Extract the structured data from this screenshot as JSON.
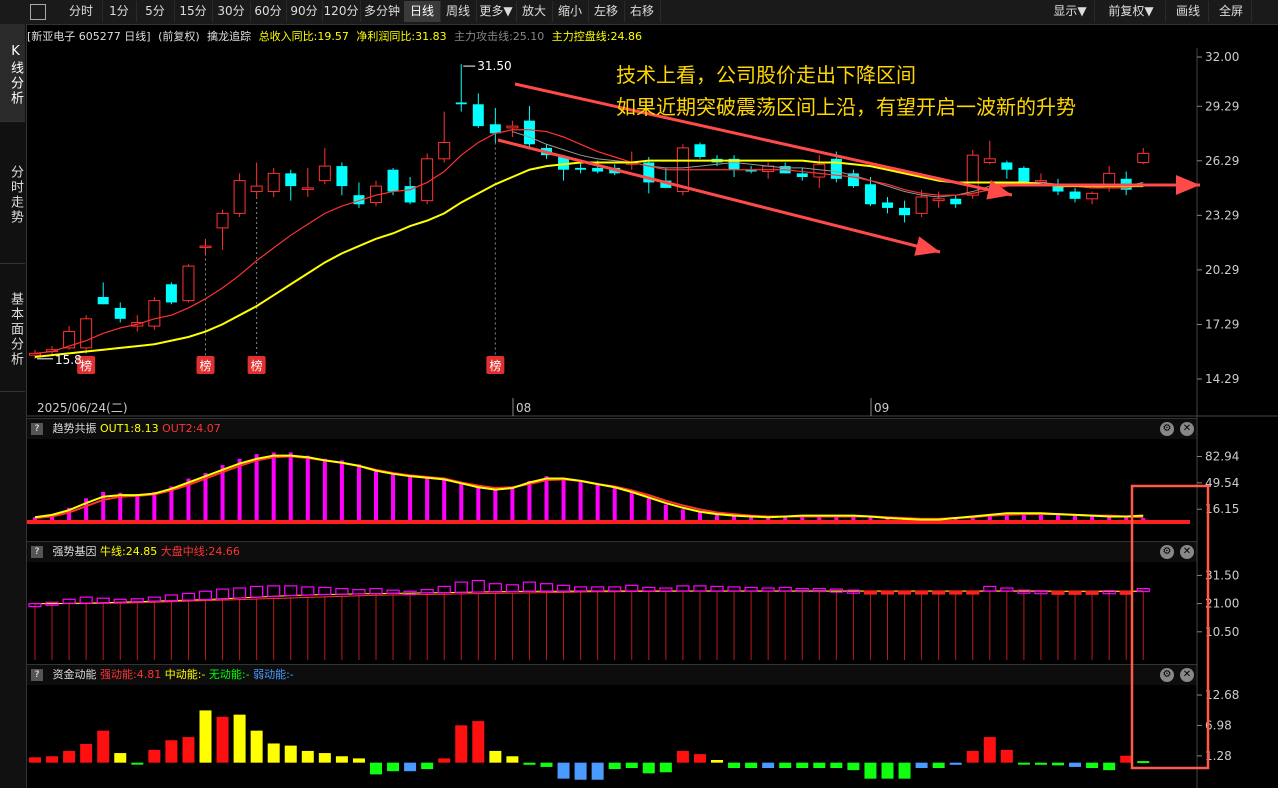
{
  "toolbar": {
    "items": [
      "分时",
      "1分",
      "5分",
      "15分",
      "30分",
      "60分",
      "90分",
      "120分",
      "多分钟",
      "日线",
      "周线",
      "更多▼",
      "放大",
      "缩小",
      "左移",
      "右移"
    ],
    "active": "日线",
    "right_items": [
      "显示▼",
      "前复权▼",
      "画线",
      "全屏"
    ]
  },
  "left_tabs": [
    "K线分析",
    "分时走势",
    "基本面分析"
  ],
  "info": {
    "stock": "[新亚电子 605277 日线]",
    "adjust": "(前复权)",
    "indicator": "擒龙追踪",
    "rev": "总收入同比:19.57",
    "profit": "净利润同比:31.83",
    "attack": "主力攻击线:25.10",
    "control": "主力控盘线:24.86"
  },
  "colors": {
    "up": "#ff3232",
    "down": "#00ffff",
    "ma_short": "#ff3232",
    "ma_long": "#ffff00",
    "ma_mid": "#999999",
    "annotation": "#ffd700",
    "arrow": "#ff4a4a"
  },
  "annotation": {
    "line1": "技术上看，公司股价走出下降区间",
    "line2": "如果近期突破震荡区间上沿，有望开启一波新的升势"
  },
  "price_labels": {
    "high": "31.50",
    "low": "15.8"
  },
  "badge_text": "榜",
  "date_labels": {
    "start": "2025/06/24(二)",
    "m1": "08",
    "m2": "09"
  },
  "chart_data": [
    {
      "type": "candlestick",
      "name": "main",
      "y_ticks": [
        "32.00",
        "29.29",
        "26.29",
        "23.29",
        "20.29",
        "17.29",
        "14.29"
      ],
      "ylim": [
        14.29,
        32.0
      ],
      "candles": [
        [
          15.6,
          15.9,
          15.4,
          15.7
        ],
        [
          15.8,
          16.1,
          15.6,
          15.9
        ],
        [
          16.0,
          17.2,
          15.9,
          16.9
        ],
        [
          16.0,
          17.8,
          15.8,
          17.6
        ],
        [
          18.8,
          19.6,
          18.4,
          18.4
        ],
        [
          18.2,
          18.5,
          17.4,
          17.6
        ],
        [
          17.2,
          17.8,
          16.9,
          17.4
        ],
        [
          17.2,
          18.8,
          17.0,
          18.6
        ],
        [
          19.5,
          19.6,
          18.4,
          18.5
        ],
        [
          18.6,
          20.6,
          18.5,
          20.5
        ],
        [
          21.6,
          22.0,
          21.2,
          21.6
        ],
        [
          22.6,
          23.6,
          21.4,
          23.4
        ],
        [
          23.4,
          25.6,
          23.2,
          25.2
        ],
        [
          24.6,
          26.2,
          24.3,
          24.9
        ],
        [
          24.6,
          25.9,
          24.3,
          25.6
        ],
        [
          25.6,
          25.8,
          24.1,
          24.9
        ],
        [
          24.8,
          25.9,
          24.3,
          24.8
        ],
        [
          25.2,
          27.0,
          25.0,
          26.0
        ],
        [
          26.0,
          26.2,
          24.4,
          24.9
        ],
        [
          24.4,
          25.1,
          23.7,
          23.9
        ],
        [
          24.0,
          25.2,
          23.8,
          24.9
        ],
        [
          25.8,
          25.9,
          24.4,
          24.6
        ],
        [
          24.9,
          25.4,
          23.9,
          24.0
        ],
        [
          24.1,
          26.7,
          23.9,
          26.4
        ],
        [
          26.4,
          29.0,
          26.2,
          27.3
        ],
        [
          29.5,
          31.6,
          29.0,
          29.4
        ],
        [
          29.4,
          30.0,
          28.1,
          28.2
        ],
        [
          28.3,
          29.2,
          27.3,
          27.8
        ],
        [
          28.1,
          28.5,
          27.6,
          28.2
        ],
        [
          28.5,
          29.3,
          27.0,
          27.2
        ],
        [
          27.0,
          27.2,
          26.4,
          26.6
        ],
        [
          26.5,
          26.6,
          25.2,
          25.8
        ],
        [
          25.9,
          26.2,
          25.6,
          25.8
        ],
        [
          25.9,
          26.3,
          25.6,
          25.7
        ],
        [
          25.9,
          26.1,
          25.5,
          25.6
        ],
        [
          26.1,
          26.8,
          25.8,
          26.2
        ],
        [
          26.2,
          26.5,
          24.5,
          25.1
        ],
        [
          25.2,
          25.9,
          24.8,
          24.8
        ],
        [
          24.6,
          27.2,
          24.4,
          27.0
        ],
        [
          27.2,
          27.3,
          26.4,
          26.5
        ],
        [
          26.4,
          26.6,
          26.0,
          26.2
        ],
        [
          26.4,
          26.6,
          25.4,
          25.8
        ],
        [
          25.8,
          26.0,
          25.6,
          25.7
        ],
        [
          25.7,
          26.2,
          25.3,
          26.0
        ],
        [
          26.0,
          26.2,
          25.6,
          25.6
        ],
        [
          25.6,
          25.9,
          25.2,
          25.4
        ],
        [
          25.4,
          26.6,
          24.8,
          26.1
        ],
        [
          26.4,
          26.8,
          25.1,
          25.3
        ],
        [
          25.6,
          25.8,
          24.8,
          24.9
        ],
        [
          25.0,
          25.4,
          23.8,
          23.9
        ],
        [
          24.0,
          24.3,
          23.4,
          23.7
        ],
        [
          23.7,
          24.1,
          22.9,
          23.3
        ],
        [
          23.4,
          24.7,
          23.2,
          24.3
        ],
        [
          24.1,
          24.6,
          23.7,
          24.2
        ],
        [
          24.2,
          24.4,
          23.7,
          23.9
        ],
        [
          24.4,
          26.9,
          24.2,
          26.6
        ],
        [
          26.2,
          27.4,
          26.1,
          26.4
        ],
        [
          26.2,
          26.3,
          25.3,
          25.8
        ],
        [
          25.9,
          26.0,
          25.0,
          25.1
        ],
        [
          25.2,
          25.6,
          25.0,
          25.2
        ],
        [
          25.0,
          25.3,
          24.4,
          24.6
        ],
        [
          24.6,
          24.8,
          24.0,
          24.2
        ],
        [
          24.2,
          24.6,
          23.9,
          24.5
        ],
        [
          24.8,
          26.0,
          24.6,
          25.6
        ],
        [
          25.3,
          25.7,
          24.4,
          24.7
        ],
        [
          26.2,
          27.0,
          26.1,
          26.7
        ]
      ],
      "ma_short": [
        15.7,
        15.8,
        16.1,
        16.4,
        16.8,
        17.1,
        17.3,
        17.6,
        17.8,
        18.2,
        18.7,
        19.3,
        20.0,
        20.8,
        21.5,
        22.2,
        22.8,
        23.4,
        23.8,
        24.1,
        24.4,
        24.6,
        24.7,
        25.1,
        25.7,
        26.6,
        27.3,
        27.8,
        28.0,
        28.0,
        27.9,
        27.6,
        27.2,
        26.8,
        26.5,
        26.2,
        26.0,
        25.8,
        25.8,
        25.8,
        25.8,
        25.8,
        25.8,
        25.8,
        25.8,
        25.7,
        25.6,
        25.5,
        25.4,
        25.2,
        25.0,
        24.7,
        24.5,
        24.4,
        24.4,
        24.5,
        24.7,
        24.9,
        25.0,
        25.0,
        25.0,
        24.9,
        24.8,
        24.8,
        24.8,
        25.0
      ],
      "ma_long": [
        15.5,
        15.6,
        15.7,
        15.8,
        15.9,
        16.0,
        16.1,
        16.2,
        16.4,
        16.6,
        16.9,
        17.3,
        17.8,
        18.3,
        18.9,
        19.5,
        20.1,
        20.7,
        21.2,
        21.6,
        22.0,
        22.3,
        22.7,
        23.0,
        23.4,
        24.0,
        24.5,
        25.0,
        25.4,
        25.8,
        26.0,
        26.1,
        26.2,
        26.2,
        26.2,
        26.2,
        26.3,
        26.3,
        26.3,
        26.3,
        26.3,
        26.3,
        26.3,
        26.3,
        26.3,
        26.3,
        26.2,
        26.2,
        26.1,
        26.0,
        25.8,
        25.6,
        25.4,
        25.2,
        25.1,
        25.1,
        25.1,
        25.1,
        25.1,
        25.0,
        24.9,
        24.9,
        24.9,
        24.9,
        24.9,
        24.9
      ],
      "ma_mid": [
        null,
        null,
        null,
        null,
        null,
        null,
        null,
        null,
        null,
        null,
        null,
        null,
        null,
        null,
        null,
        null,
        null,
        null,
        null,
        null,
        null,
        null,
        null,
        null,
        null,
        null,
        null,
        null,
        27.9,
        27.6,
        27.2,
        26.9,
        26.6,
        26.4,
        26.3,
        26.2,
        26.0,
        25.9,
        25.9,
        26.0,
        26.1,
        26.2,
        26.1,
        26.0,
        25.9,
        25.9,
        25.8,
        25.7,
        25.5,
        25.2,
        24.9,
        24.6,
        24.4,
        24.3,
        24.4,
        24.6,
        24.9,
        25.0,
        25.1,
        25.1,
        25.0,
        24.9,
        24.8,
        24.9,
        24.9,
        25.1
      ],
      "badges_at": [
        3,
        10,
        13,
        27
      ]
    },
    {
      "type": "bar",
      "name": "趋势共振",
      "label_out1": "OUT1:8.13",
      "label_out2": "OUT2:4.07",
      "y_ticks": [
        "82.94",
        "49.54",
        "16.15"
      ],
      "ylim": [
        0,
        100
      ],
      "values": [
        6,
        10,
        18,
        30,
        38,
        37,
        35,
        38,
        45,
        55,
        62,
        72,
        80,
        86,
        88,
        88,
        84,
        80,
        78,
        73,
        66,
        62,
        60,
        58,
        56,
        50,
        44,
        40,
        44,
        52,
        58,
        56,
        52,
        48,
        44,
        38,
        30,
        22,
        16,
        12,
        9,
        7,
        6,
        5,
        7,
        9,
        8,
        8,
        9,
        7,
        6,
        5,
        4,
        4,
        6,
        8,
        10,
        12,
        12,
        11,
        10,
        9,
        8,
        7,
        6,
        5
      ],
      "out1": [
        6,
        9,
        15,
        24,
        32,
        34,
        34,
        36,
        42,
        50,
        58,
        66,
        74,
        80,
        84,
        84,
        82,
        78,
        75,
        71,
        65,
        61,
        58,
        56,
        54,
        49,
        44,
        41,
        43,
        50,
        55,
        55,
        52,
        48,
        44,
        38,
        31,
        24,
        18,
        13,
        10,
        8,
        7,
        6,
        7,
        8,
        8,
        8,
        8,
        7,
        5,
        4,
        3,
        3,
        5,
        7,
        9,
        11,
        11,
        11,
        10,
        9,
        8,
        7,
        7,
        8
      ],
      "out2": [
        5,
        7,
        12,
        20,
        28,
        32,
        33,
        35,
        40,
        47,
        55,
        63,
        71,
        78,
        82,
        83,
        81,
        78,
        75,
        71,
        66,
        62,
        59,
        57,
        55,
        50,
        46,
        43,
        44,
        48,
        53,
        54,
        52,
        48,
        45,
        40,
        34,
        27,
        21,
        16,
        12,
        10,
        8,
        7,
        7,
        7,
        7,
        7,
        7,
        7,
        6,
        5,
        4,
        4,
        5,
        6,
        8,
        9,
        10,
        10,
        10,
        9,
        8,
        8,
        7,
        6
      ]
    },
    {
      "type": "bar",
      "name": "强势基因",
      "label_niu": "牛线:24.85",
      "label_zz": "大盘中线:24.66",
      "y_ticks": [
        "31.50",
        "21.00",
        "10.50"
      ],
      "ylim": [
        0,
        35
      ],
      "values": [
        21,
        21,
        21,
        21,
        21.2,
        21.4,
        21.6,
        21.8,
        22,
        22.2,
        22.4,
        22.6,
        22.8,
        23,
        23.2,
        23.4,
        23.6,
        23.8,
        24,
        24.2,
        24.3,
        24.4,
        24.5,
        24.6,
        24.7,
        24.8,
        24.9,
        25,
        25.1,
        25.2,
        25.3,
        25.4,
        25.4,
        25.5,
        25.5,
        25.6,
        25.6,
        25.6,
        25.6,
        25.6,
        25.6,
        25.6,
        25.6,
        25.6,
        25.6,
        25.6,
        25.6,
        25.6,
        25.6,
        25.6,
        25.6,
        25.6,
        25.6,
        25.6,
        25.6,
        25.6,
        25.6,
        25.6,
        25.6,
        25.6,
        25.6,
        25.6,
        25.6,
        25.6,
        25.6,
        25.6
      ],
      "boxes": [
        21,
        21.5,
        22.6,
        23.4,
        23.0,
        22.6,
        22.8,
        23.4,
        24.2,
        24.8,
        25.6,
        26.4,
        26.8,
        27.4,
        27.6,
        27.6,
        27.2,
        27.0,
        26.6,
        26.2,
        26.6,
        26.0,
        25.6,
        26.2,
        27.4,
        29.0,
        29.6,
        28.4,
        28.0,
        29.0,
        28.4,
        27.8,
        27.2,
        27.2,
        27.2,
        27.8,
        27.0,
        26.8,
        27.6,
        27.6,
        27.4,
        27.2,
        27.0,
        26.8,
        27.0,
        26.6,
        26.6,
        26.4,
        26.0,
        25.4,
        25.0,
        24.8,
        24.9,
        24.9,
        25.0,
        25.6,
        27.4,
        26.8,
        26.0,
        25.8,
        25.4,
        25.2,
        25.2,
        25.8,
        25.4,
        26.6
      ],
      "niu": [
        21,
        21,
        21.1,
        21.2,
        21.3,
        21.5,
        21.7,
        21.9,
        22.1,
        22.3,
        22.5,
        22.8,
        23.1,
        23.4,
        23.7,
        24,
        24.2,
        24.4,
        24.5,
        24.6,
        24.7,
        24.8,
        24.9,
        25,
        25.1,
        25.2,
        25.3,
        25.4,
        25.5,
        25.6,
        25.6,
        25.6,
        25.7,
        25.7,
        25.7,
        25.7,
        25.7,
        25.7,
        25.7,
        25.7,
        25.7,
        25.7,
        25.7,
        25.7,
        25.7,
        25.7,
        25.7,
        25.7,
        25.7,
        25.7,
        25.7,
        25.7,
        25.7,
        25.7,
        25.7,
        25.7,
        25.7,
        25.7,
        25.7,
        25.7,
        25.6,
        25.6,
        25.6,
        25.6,
        25.6,
        25.6
      ],
      "zz": [
        21,
        21,
        21,
        21,
        21.1,
        21.2,
        21.3,
        21.5,
        21.7,
        21.9,
        22.1,
        22.3,
        22.5,
        22.7,
        22.9,
        23.1,
        23.3,
        23.5,
        23.7,
        23.9,
        24.1,
        24.2,
        24.3,
        24.4,
        24.5,
        24.6,
        24.7,
        24.8,
        24.9,
        25,
        25.1,
        25.2,
        25.3,
        25.4,
        25.4,
        25.5,
        25.5,
        25.5,
        25.6,
        25.6,
        25.6,
        25.6,
        25.6,
        25.6,
        25.6,
        25.6,
        25.6,
        25.6,
        25.6,
        25.6,
        25.6,
        25.6,
        25.6,
        25.6,
        25.6,
        25.6,
        25.6,
        25.6,
        25.6,
        25.6,
        25.6,
        25.6,
        25.6,
        25.6,
        25.6,
        25.6
      ]
    },
    {
      "type": "bar",
      "name": "资金动能",
      "label_strong": "强动能:4.81",
      "label_mid": "中动能:-",
      "label_none": "无动能:-",
      "label_weak": "弱动能:-",
      "y_ticks": [
        "12.68",
        "6.98",
        "1.28"
      ],
      "ylim": [
        -4,
        14
      ],
      "values": [
        1,
        1.2,
        2.2,
        3.5,
        6,
        1.8,
        -0.2,
        2.4,
        4.2,
        4.8,
        9.8,
        8.6,
        9.0,
        6.0,
        3.6,
        3.2,
        2.2,
        1.8,
        1.2,
        0.8,
        -2.2,
        -1.6,
        -1.6,
        -1.2,
        0.8,
        7.0,
        7.8,
        2.2,
        1.2,
        -0.4,
        -0.8,
        -3.0,
        -3.2,
        -3.2,
        -1.2,
        -1.0,
        -2.0,
        -1.8,
        2.2,
        1.6,
        0.5,
        -1.0,
        -1.0,
        -1.0,
        -1.0,
        -1.0,
        -1.0,
        -1.0,
        -1.4,
        -3.0,
        -3.0,
        -3.0,
        -1.0,
        -1.0,
        -0.4,
        2.2,
        4.8,
        2.4,
        -0.2,
        -0.4,
        -0.5,
        -0.8,
        -1.0,
        -1.4,
        1.3,
        0.3
      ],
      "colors": [
        "r",
        "r",
        "r",
        "r",
        "r",
        "y",
        "g",
        "r",
        "r",
        "r",
        "y",
        "r",
        "y",
        "y",
        "y",
        "y",
        "y",
        "y",
        "y",
        "y",
        "g",
        "g",
        "b",
        "g",
        "r",
        "r",
        "r",
        "y",
        "y",
        "g",
        "g",
        "b",
        "b",
        "b",
        "g",
        "g",
        "g",
        "g",
        "r",
        "r",
        "y",
        "g",
        "g",
        "b",
        "g",
        "g",
        "g",
        "g",
        "g",
        "g",
        "g",
        "g",
        "b",
        "g",
        "b",
        "r",
        "r",
        "r",
        "g",
        "g",
        "g",
        "b",
        "g",
        "g",
        "r",
        "g"
      ]
    }
  ]
}
